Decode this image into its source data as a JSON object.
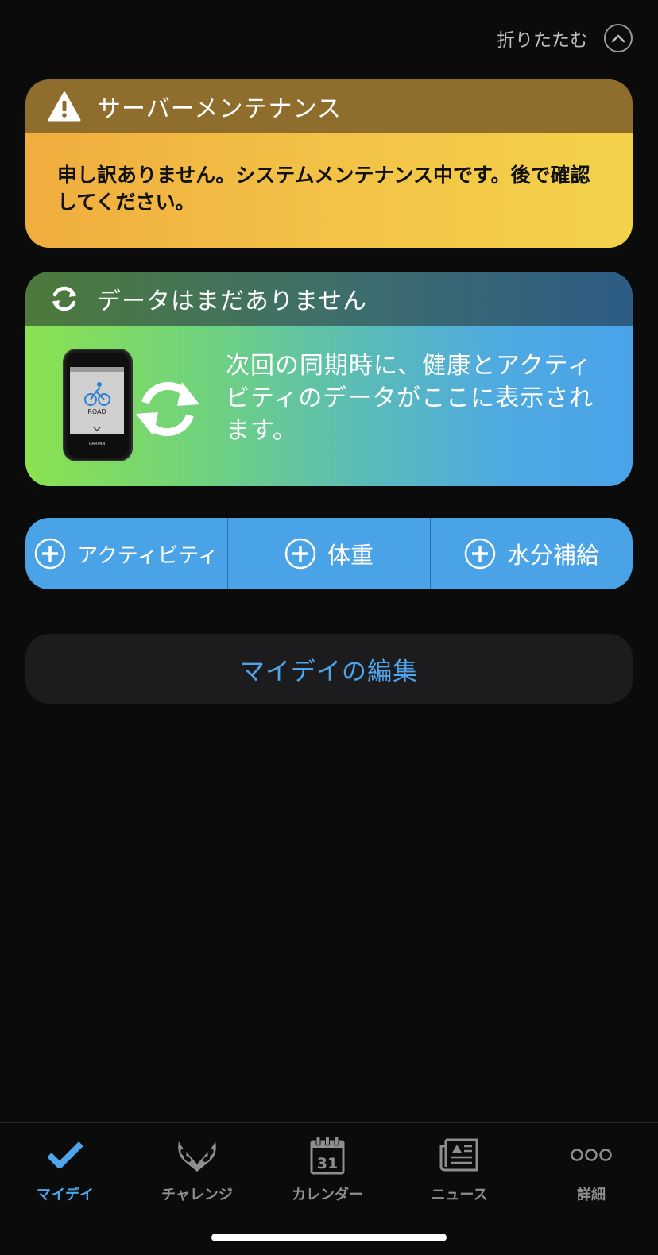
{
  "collapse": {
    "label": "折りたたむ",
    "icon": "chevron-up-icon"
  },
  "maintenance": {
    "title": "サーバーメンテナンス",
    "message": "申し訳ありません。システムメンテナンス中です。後で確認してください。",
    "icon": "warning-icon",
    "colors": {
      "header": "#8f6d2c",
      "body_start": "#f0ad3e",
      "body_end": "#f3d24a"
    }
  },
  "no_data": {
    "title": "データはまだありません",
    "description": "次回の同期時に、健康とアクティビティのデータがここに表示されます。",
    "icon": "sync-icon",
    "device": {
      "screen_label": "ROAD",
      "brand": "GARMIN"
    }
  },
  "quick_add": [
    {
      "label": "アクティビティ",
      "icon": "plus-circle-icon"
    },
    {
      "label": "体重",
      "icon": "plus-circle-icon"
    },
    {
      "label": "水分補給",
      "icon": "plus-circle-icon"
    }
  ],
  "edit_my_day": {
    "label": "マイデイの編集"
  },
  "tabs": [
    {
      "label": "マイデイ",
      "icon": "checkmark-icon",
      "active": true
    },
    {
      "label": "チャレンジ",
      "icon": "laurel-icon",
      "active": false
    },
    {
      "label": "カレンダー",
      "icon": "calendar-icon",
      "day": "31",
      "active": false
    },
    {
      "label": "ニュース",
      "icon": "newspaper-icon",
      "active": false
    },
    {
      "label": "詳細",
      "icon": "more-dots-icon",
      "active": false
    }
  ],
  "colors": {
    "accent": "#4aa3e6",
    "background": "#0b0b0b",
    "tab_inactive": "#8e8e8e"
  }
}
